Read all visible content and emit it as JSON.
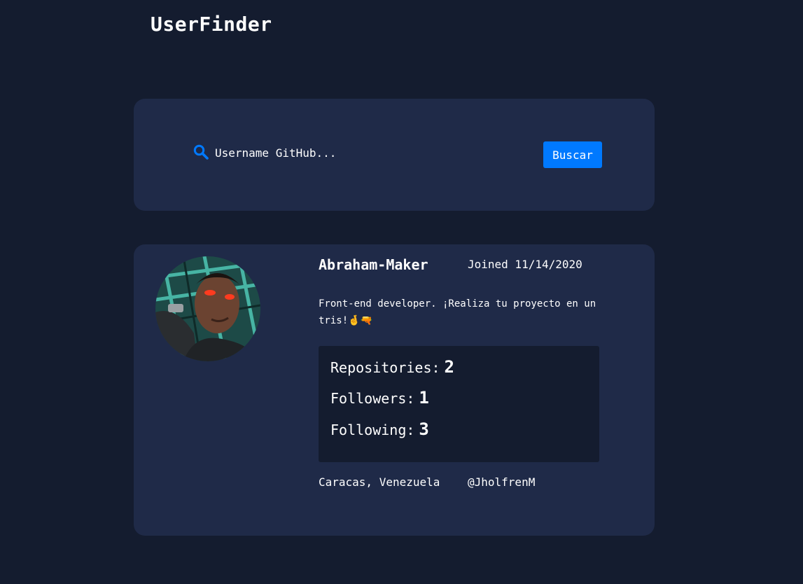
{
  "header": {
    "title": "UserFinder"
  },
  "search": {
    "placeholder": "Username GitHub...",
    "button_label": "Buscar",
    "icon": "search-icon",
    "accent_color": "#0079ff"
  },
  "profile": {
    "avatar": "avatar-photo",
    "name": "Abraham-Maker",
    "joined": "Joined 11/14/2020",
    "bio": "Front-end developer. ¡Realiza tu proyecto en un tris!🤞🔫",
    "stats": [
      {
        "label": "Repositories:",
        "value": "2"
      },
      {
        "label": "Followers:",
        "value": "1"
      },
      {
        "label": "Following:",
        "value": "3"
      }
    ],
    "location": "Caracas, Venezuela",
    "twitter": "@JholfrenM"
  },
  "theme": {
    "background": "#141c2f",
    "card": "#1f2a48",
    "text": "#ffffff"
  }
}
